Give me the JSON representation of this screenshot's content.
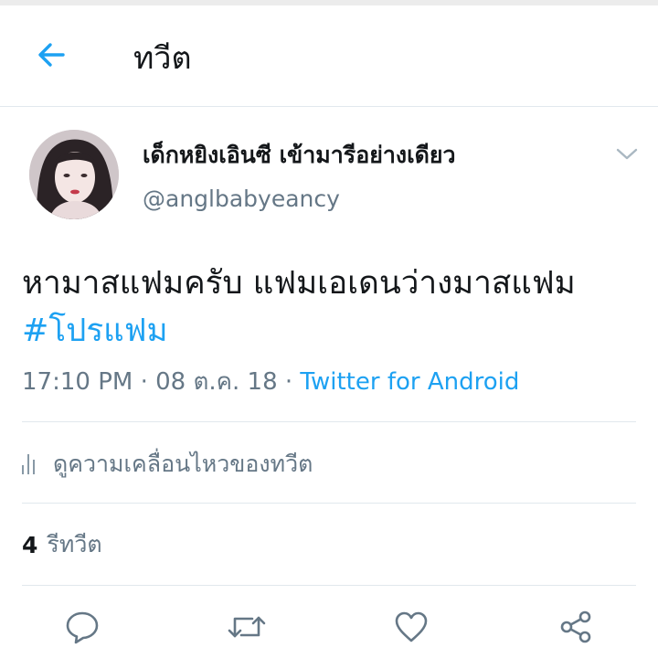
{
  "header": {
    "title": "ทวีต",
    "back_icon": "arrow-left-icon",
    "accent_color": "#1da1f2"
  },
  "tweet": {
    "author": {
      "display_name": "เด็กหยิงเอินซี เข้ามารีอย่างเดียว",
      "handle": "@anglbabyeancy",
      "avatar": "avatar-photo"
    },
    "text": "หามาสแฟมครับ แฟมเอเดนว่างมาสแฟม",
    "hashtag": "#โปรแฟม",
    "time": "17:10 PM",
    "separator": "·",
    "date": "08 ต.ค. 18",
    "source": "Twitter for Android"
  },
  "activity": {
    "label": "ดูความเคลื่อนไหวของทวีต",
    "icon": "bar-chart-icon"
  },
  "stats": {
    "retweet_count": "4",
    "retweet_label": "รีทวีต"
  },
  "actions": {
    "reply_icon": "reply-icon",
    "retweet_icon": "retweet-icon",
    "like_icon": "heart-icon",
    "share_icon": "share-icon",
    "icon_color": "#657786"
  }
}
